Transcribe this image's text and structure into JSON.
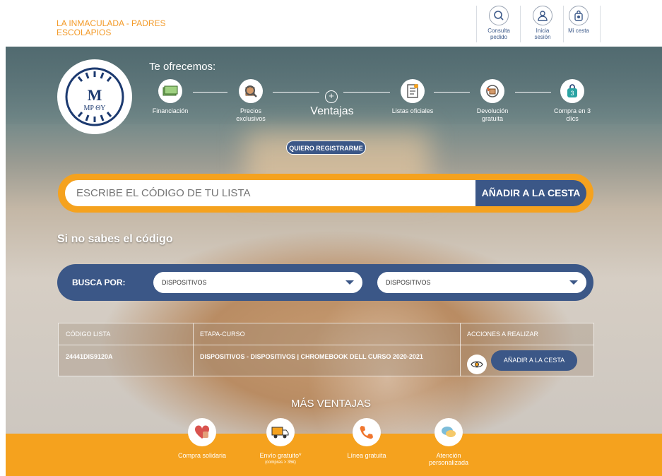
{
  "header": {
    "school_name": "LA INMACULADA - PADRES ESCOLAPIOS",
    "buttons": [
      {
        "label": "Consulta pedido",
        "icon": "search-icon"
      },
      {
        "label": "Inicia sesión",
        "icon": "user-icon"
      },
      {
        "label": "Mi cesta",
        "icon": "bag-icon"
      }
    ]
  },
  "hero": {
    "logo_text": "MP ΘY",
    "offer_title": "Te ofrecemos:",
    "center_label": "Ventajas",
    "advantages": [
      {
        "label": "Financiación",
        "icon": "money-icon"
      },
      {
        "label": "Precios exclusivos",
        "icon": "magnifier-box-icon"
      },
      {
        "label": "Listas oficiales",
        "icon": "checklist-icon"
      },
      {
        "label": "Devolución gratuita",
        "icon": "return-icon"
      },
      {
        "label": "Compra en 3 clics",
        "icon": "bag-3-icon"
      }
    ],
    "register_button": "QUIERO REGISTRARME"
  },
  "search": {
    "placeholder": "ESCRIBE EL CÓDIGO DE TU LISTA",
    "button": "AÑADIR A LA CESTA"
  },
  "filter": {
    "no_code_text": "Si no sabes el código",
    "label": "BUSCA POR:",
    "select1": "DISPOSITIVOS",
    "select2": "DISPOSITIVOS"
  },
  "table": {
    "headers": [
      "CÓDIGO LISTA",
      "ETAPA-CURSO",
      "ACCIONES A REALIZAR"
    ],
    "rows": [
      {
        "code": "24441DIS9120A",
        "stage": "DISPOSITIVOS - DISPOSITIVOS | CHROMEBOOK DELL CURSO 2020-2021",
        "action": "AÑADIR A LA CESTA"
      }
    ]
  },
  "more": {
    "title": "MÁS VENTAJAS",
    "items": [
      {
        "label": "Compra solidaria",
        "note": "",
        "icon": "heart-hand-icon"
      },
      {
        "label": "Envío gratuito*",
        "note": "(compras > 35€)",
        "icon": "truck-icon"
      },
      {
        "label": "Línea gratuita",
        "note": "",
        "icon": "phone-icon"
      },
      {
        "label": "Atención personalizada",
        "note": "",
        "icon": "chat-icon"
      }
    ]
  },
  "colors": {
    "brand_blue": "#3b5787",
    "brand_orange": "#f5a21e"
  }
}
